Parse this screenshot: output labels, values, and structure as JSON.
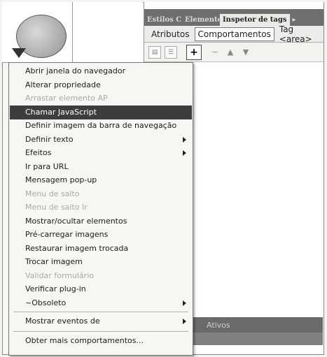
{
  "panel": {
    "tabs": [
      {
        "label": "Estilos CSS"
      },
      {
        "label": "Elementos AP"
      },
      {
        "label": "Inspetor de tags"
      }
    ],
    "subtabs": [
      {
        "label": "Atributos"
      },
      {
        "label": "Comportamentos"
      },
      {
        "label": "Tag <area>"
      }
    ],
    "bottom_label": "Ativos"
  },
  "menu": {
    "items": [
      {
        "label": "Abrir janela do navegador",
        "state": "normal",
        "submenu": false
      },
      {
        "label": "Alterar propriedade",
        "state": "normal",
        "submenu": false
      },
      {
        "label": "Arrastar elemento AP",
        "state": "disabled",
        "submenu": false
      },
      {
        "label": "Chamar JavaScript",
        "state": "selected",
        "submenu": false
      },
      {
        "label": "Definir imagem da barra de navegação",
        "state": "normal",
        "submenu": false
      },
      {
        "label": "Definir texto",
        "state": "normal",
        "submenu": true
      },
      {
        "label": "Efeitos",
        "state": "normal",
        "submenu": true
      },
      {
        "label": "Ir para URL",
        "state": "normal",
        "submenu": false
      },
      {
        "label": "Mensagem pop-up",
        "state": "normal",
        "submenu": false
      },
      {
        "label": "Menu de salto",
        "state": "disabled",
        "submenu": false
      },
      {
        "label": "Menu de salto Ir",
        "state": "disabled",
        "submenu": false
      },
      {
        "label": "Mostrar/ocultar elementos",
        "state": "normal",
        "submenu": false
      },
      {
        "label": "Pré-carregar imagens",
        "state": "normal",
        "submenu": false
      },
      {
        "label": "Restaurar imagem trocada",
        "state": "normal",
        "submenu": false
      },
      {
        "label": "Trocar imagem",
        "state": "normal",
        "submenu": false
      },
      {
        "label": "Validar formulário",
        "state": "disabled",
        "submenu": false
      },
      {
        "label": "Verificar plug-in",
        "state": "normal",
        "submenu": false
      },
      {
        "label": "~Obsoleto",
        "state": "normal",
        "submenu": true
      }
    ],
    "show_events": {
      "label": "Mostrar eventos de",
      "submenu": true
    },
    "more": {
      "label": "Obter mais comportamentos..."
    }
  }
}
